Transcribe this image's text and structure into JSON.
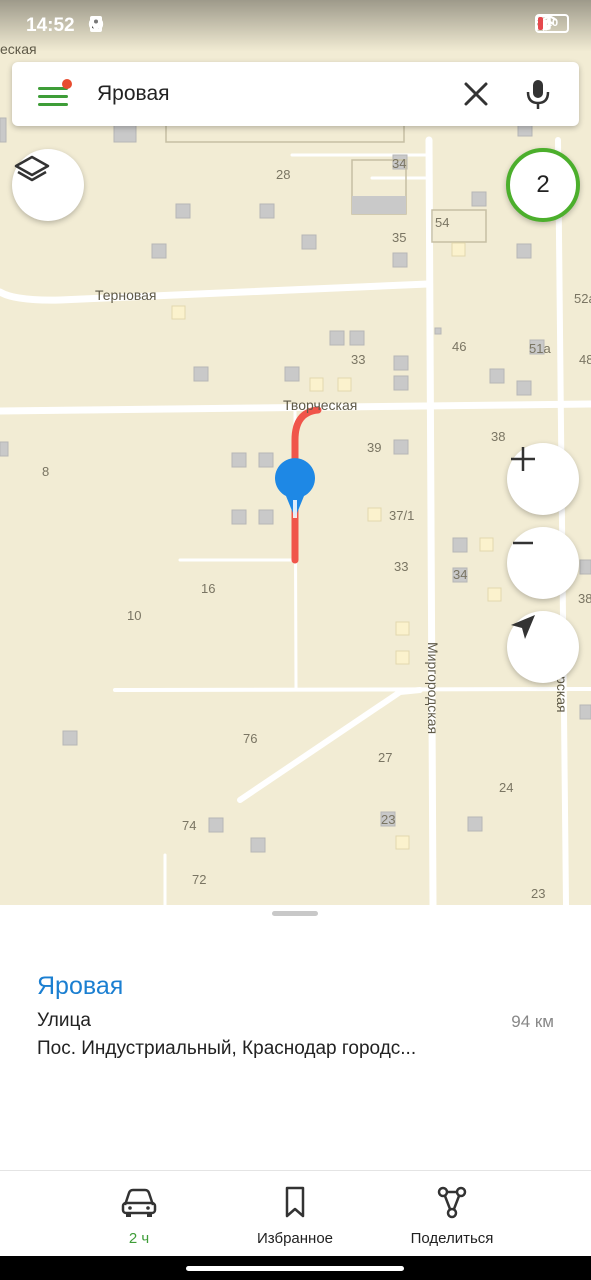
{
  "status_bar": {
    "time": "14:52",
    "battery_level": "10",
    "icons": [
      "sim-icon",
      "app-n-icon",
      "music-icon",
      "location-icon",
      "navigation-arrow-icon",
      "volte-icon",
      "signal-icon",
      "signal-icon",
      "wifi-icon",
      "battery-icon"
    ]
  },
  "search": {
    "query": "Яровая",
    "menu_icon": "menu-icon",
    "clear_icon": "close-icon",
    "mic_icon": "mic-icon"
  },
  "map": {
    "top_edge_label": "еская",
    "streets": {
      "ternovaya": "Терновая",
      "tvorcheskaya": "Творческая",
      "mirgorodskaya": "Миргородская",
      "right_partial": "рская"
    },
    "house_numbers": {
      "n28": "28",
      "n34a": "34",
      "n54": "54",
      "n35": "35",
      "n52a": "52а",
      "n33a": "33",
      "n46": "46",
      "n51a": "51а",
      "n48": "48",
      "n39": "39",
      "n38a": "38",
      "n8": "8",
      "n37_1": "37/1",
      "n33b": "33",
      "n34b": "34",
      "n16": "16",
      "n10": "10",
      "n38b": "38",
      "n76": "76",
      "n27": "27",
      "n24": "24",
      "n74": "74",
      "n23a": "23",
      "n72": "72",
      "n23b": "23"
    },
    "traffic_level": "2",
    "route_color": "#f0554a",
    "pin_color": "#1e88e5"
  },
  "controls": {
    "layers_icon": "layers-icon",
    "zoom_in_icon": "plus-icon",
    "zoom_out_icon": "minus-icon",
    "locate_icon": "locate-arrow-icon"
  },
  "place_card": {
    "title": "Яровая",
    "type": "Улица",
    "address": "Пос. Индустриальный, Краснодар городс...",
    "distance": "94 км"
  },
  "bottom_nav": {
    "route_label": "2 ч",
    "favorites_label": "Избранное",
    "share_label": "Поделиться"
  },
  "colors": {
    "accent_green": "#3e9d38",
    "title_blue": "#1b7fd1",
    "map_background": "#f2ecd4"
  }
}
